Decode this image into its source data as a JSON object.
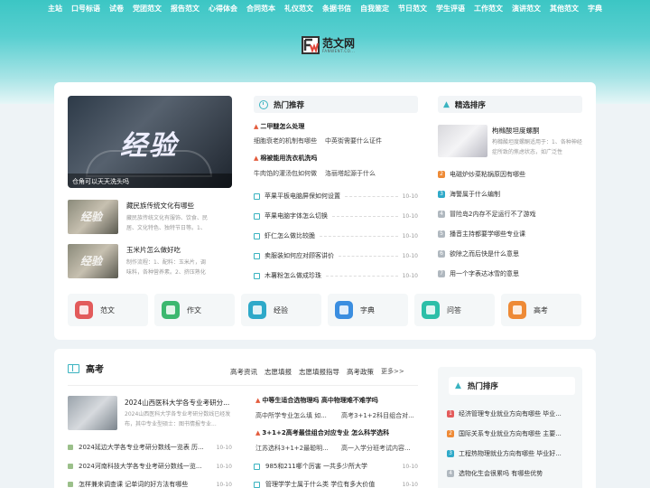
{
  "topnav": [
    "主站",
    "口号标语",
    "试卷",
    "党团范文",
    "报告范文",
    "心得体会",
    "合同范本",
    "礼仪范文",
    "条据书信",
    "自我鉴定",
    "节日范文",
    "学生评语",
    "工作范文",
    "演讲范文",
    "其他范文",
    "字典"
  ],
  "logo": {
    "text": "范文网",
    "sub": "FANWENT.CO..."
  },
  "featured": {
    "big": "经验",
    "caption": "仓角可以天天洗头吗"
  },
  "left_items": [
    {
      "title": "藏民族传统文化有哪些",
      "desc": "藏民族传统文化有服饰、饮食、民居、文化特色、独特节日等。1、服饰：由于地",
      "thumb": "经验"
    },
    {
      "title": "玉米片怎么做好吃",
      "desc": "制作流程：1、配料：玉米片，调味料，各种营养素。2、挤压熟化成型：玉米片",
      "thumb": "经验"
    }
  ],
  "hot": {
    "title": "热门推荐",
    "headline1": "二甲醚怎么处理",
    "sub1a": "细胞衰老的机制有哪些",
    "sub1b": "中英街需要什么证件",
    "headline2": "棉被能用洗衣机洗吗",
    "sub2a": "牛肉馅的灌汤包如何做",
    "sub2b": "洛丽塔起源于什么",
    "list": [
      {
        "text": "苹果平板电脑屏保如何设置",
        "date": "10-10"
      },
      {
        "text": "苹果电脑字体怎么切换",
        "date": "10-10"
      },
      {
        "text": "虾仁怎么做比较脆",
        "date": "10-10"
      },
      {
        "text": "卖服装如何应对顾客讲价",
        "date": "10-10"
      },
      {
        "text": "木薯粉怎么做成珍珠",
        "date": "10-10"
      }
    ]
  },
  "rank": {
    "title": "精选排序",
    "top_title": "枸橼酸坦度螺酮",
    "top_desc": "枸橼酸坦度螺酮适用于：1、各种神经症所致的焦虑状态，如广泛性",
    "items": [
      {
        "n": "2",
        "text": "电磁炉炒菜粘锅原因有哪些"
      },
      {
        "n": "3",
        "text": "海警属于什么编制"
      },
      {
        "n": "4",
        "text": "冒险岛2内存不足运行不了游戏"
      },
      {
        "n": "5",
        "text": "播音主持都要学哪些专业课"
      },
      {
        "n": "6",
        "text": "欲除之而后快是什么意思"
      },
      {
        "n": "7",
        "text": "用一个字表达冰雪的意思"
      }
    ]
  },
  "categories": [
    {
      "label": "范文",
      "color": "#e25b5b"
    },
    {
      "label": "作文",
      "color": "#3cb86f"
    },
    {
      "label": "经验",
      "color": "#2ea9c9"
    },
    {
      "label": "字典",
      "color": "#3b8ee0"
    },
    {
      "label": "问答",
      "color": "#2cbfa8"
    },
    {
      "label": "高考",
      "color": "#ee8a36"
    }
  ],
  "gaokao": {
    "title": "高考",
    "tabs": [
      "高考资讯",
      "志愿填报",
      "志愿填报指导",
      "高考政策",
      "更多>>"
    ],
    "feature_title": "2024山西医科大学各专业考研分...",
    "feature_desc": "2024山西医科大学各专业考研分数线已经发布，其中专业型硕士：图书情报专业...",
    "list": [
      {
        "text": "2024延边大学各专业考研分数线一览表 历...",
        "date": "10-10"
      },
      {
        "text": "2024河南科技大学各专业考研分数线一览...",
        "date": "10-10"
      },
      {
        "text": "怎样兼来调查课 记单词的好方法有哪些",
        "date": "10-10"
      }
    ],
    "mid_h1": "中等生适合选物理吗 高中物理难不难学吗",
    "mid_s1a": "高中所学专业怎么填 如...",
    "mid_s1b": "高考3+1+2科目组合对...",
    "mid_h2": "3+1+2高考最佳组合对应专业 怎么科学选科",
    "mid_s2a": "江苏选科3+1+2最聪明...",
    "mid_s2b": "高一入学分班考试内容...",
    "mid_list": [
      {
        "text": "985和211哪个厉害 一共多少所大学",
        "date": "10-10"
      },
      {
        "text": "管理学学士属于什么类 学位有多大价值",
        "date": "10-10"
      }
    ]
  },
  "side_rank": {
    "title": "热门排序",
    "items": [
      {
        "n": "1",
        "text": "经济管理专业就业方向有哪些 毕业..."
      },
      {
        "n": "2",
        "text": "国际关系专业就业方向有哪些 主要..."
      },
      {
        "n": "3",
        "text": "工程热物理就业方向有哪些 毕业好..."
      },
      {
        "n": "4",
        "text": "选物化生会很累吗 有哪些优势"
      }
    ]
  },
  "colors": {
    "accent": "#3ab3c0",
    "rank1": "#e35b5b",
    "rank2": "#ee8a36",
    "rank3": "#2ea9c9",
    "rank_other": "#b0b8bf"
  }
}
